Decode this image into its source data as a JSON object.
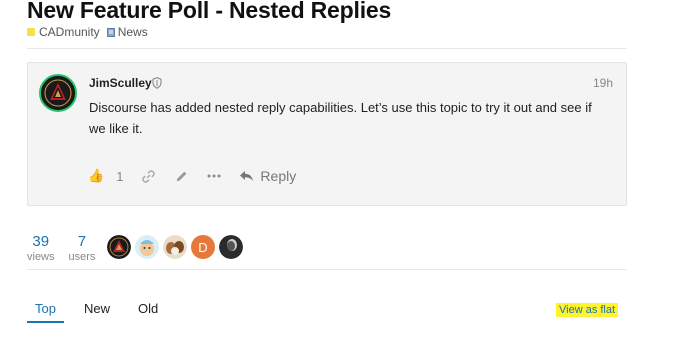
{
  "topic": {
    "title": "New Feature Poll - Nested Replies"
  },
  "breadcrumbs": [
    {
      "label": "CADmunity",
      "color": "#f5e04f"
    },
    {
      "label": "News"
    }
  ],
  "post": {
    "username": "JimSculley",
    "time": "19h",
    "body": "Discourse has added nested reply capabilities. Let’s use this topic to try it out and see if we like it.",
    "like_count": "1",
    "reply_label": "Reply"
  },
  "stats": {
    "views_num": "39",
    "views_label": "views",
    "users_num": "7",
    "users_label": "users"
  },
  "participants": [
    {
      "icon": "atlanta-united-avatar-icon"
    },
    {
      "icon": "cartoon-character-avatar-icon"
    },
    {
      "icon": "dogs-avatar-icon"
    },
    {
      "letter": "D",
      "color": "#e6783c"
    },
    {
      "icon": "dark-figure-avatar-icon"
    }
  ],
  "tabs": [
    {
      "label": "Top"
    },
    {
      "label": "New"
    },
    {
      "label": "Old"
    }
  ],
  "view_as_flat": "View as flat",
  "colors": {
    "accent": "#1874b3",
    "highlight": "#fff32f"
  }
}
